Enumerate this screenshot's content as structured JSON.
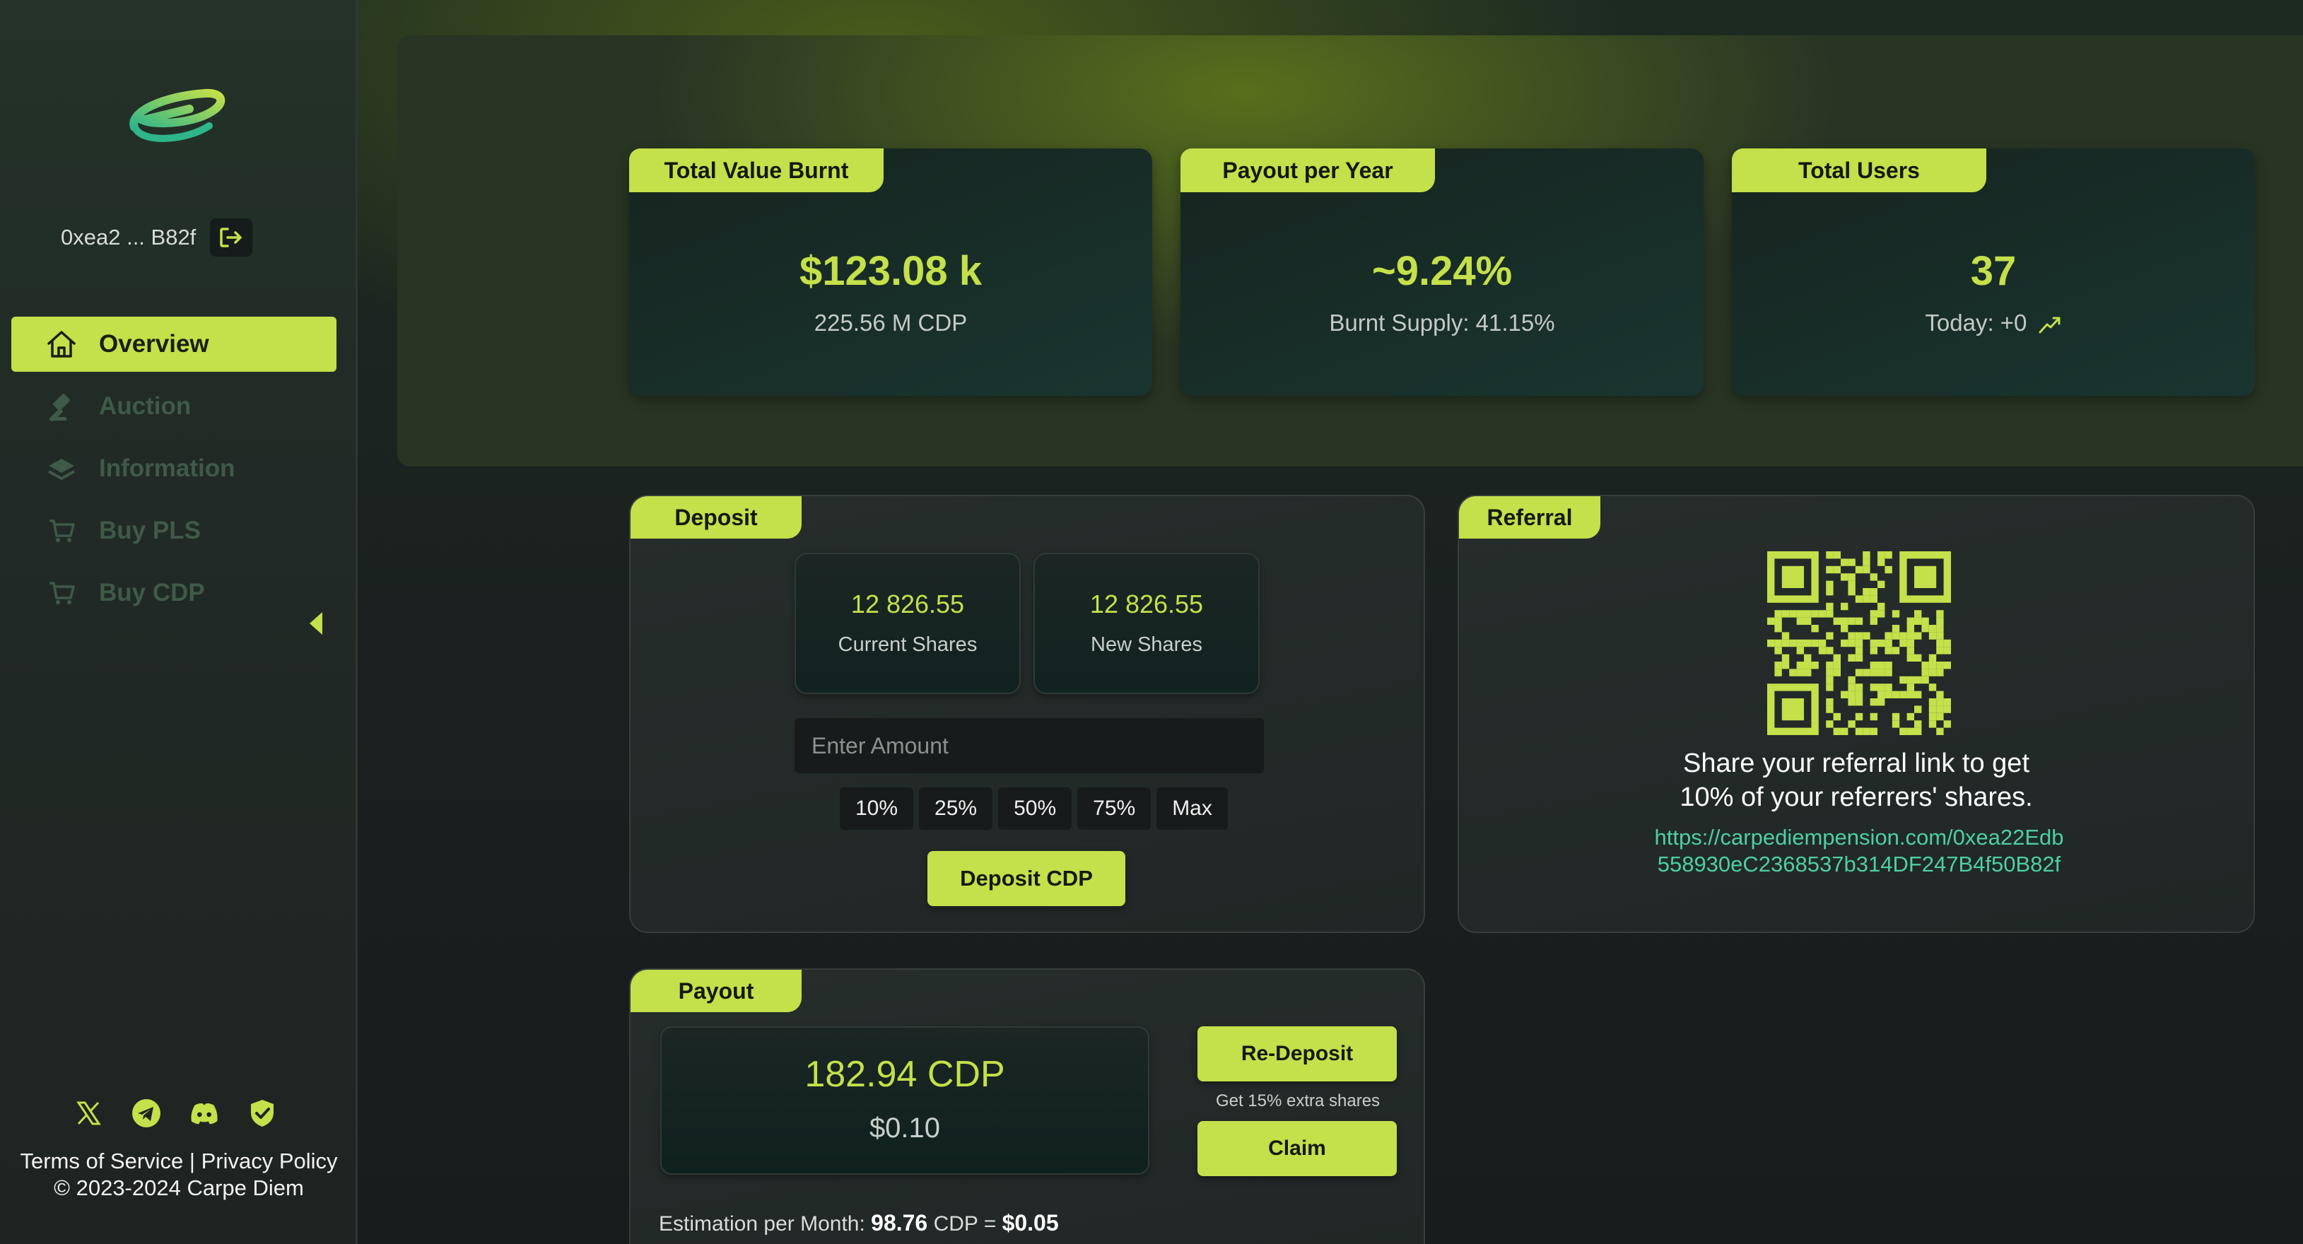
{
  "sidebar": {
    "wallet": "0xea2 ... B82f",
    "nav": [
      {
        "label": "Overview",
        "icon": "home-icon",
        "active": true
      },
      {
        "label": "Auction",
        "icon": "gavel-icon"
      },
      {
        "label": "Information",
        "icon": "layers-icon"
      },
      {
        "label": "Buy PLS",
        "icon": "cart-icon"
      },
      {
        "label": "Buy CDP",
        "icon": "cart-icon"
      }
    ],
    "socials": [
      "x-icon",
      "telegram-icon",
      "discord-icon",
      "shield-check-icon"
    ],
    "terms": "Terms of Service",
    "separator": "|",
    "privacy": "Privacy Policy",
    "copyright": "© 2023-2024 Carpe Diem"
  },
  "stats": {
    "burnt": {
      "title": "Total Value Burnt",
      "value": "$123.08 k",
      "sub": "225.56 M CDP"
    },
    "payout": {
      "title": "Payout per Year",
      "value": "~9.24%",
      "sub": "Burnt Supply: 41.15%"
    },
    "users": {
      "title": "Total Users",
      "value": "37",
      "sub": "Today: +0"
    }
  },
  "deposit": {
    "title": "Deposit",
    "current_shares_value": "12 826.55",
    "current_shares_label": "Current Shares",
    "new_shares_value": "12 826.55",
    "new_shares_label": "New Shares",
    "amount_placeholder": "Enter Amount",
    "percentages": [
      "10%",
      "25%",
      "50%",
      "75%",
      "Max"
    ],
    "button": "Deposit CDP"
  },
  "referral": {
    "title": "Referral",
    "text_line1": "Share your referral link to get",
    "text_line2": "10% of your referrers' shares.",
    "link": "https://carpediempension.com/0xea22Edb558930eC2368537b314DF247B4f50B82f"
  },
  "payout": {
    "title": "Payout",
    "amount": "182.94 CDP",
    "usd": "$0.10",
    "redeposit": "Re-Deposit",
    "extra_note": "Get 15% extra shares",
    "claim": "Claim",
    "estimate_label": "Estimation per Month:",
    "estimate_cdp": "98.76",
    "estimate_unit": "CDP =",
    "estimate_usd": "$0.05"
  },
  "colors": {
    "accent": "#c4e04a",
    "link": "#4ecfa3",
    "background": "#1b2222"
  }
}
